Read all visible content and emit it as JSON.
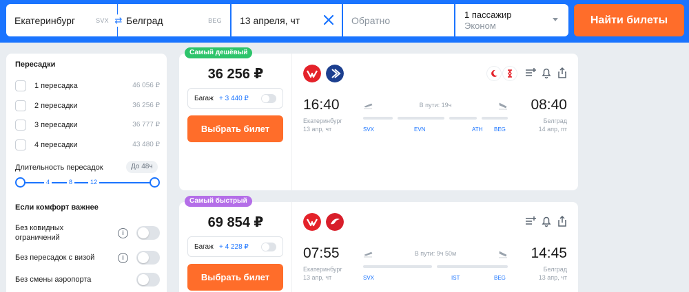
{
  "search": {
    "from_city": "Екатеринбург",
    "from_code": "SVX",
    "to_city": "Белград",
    "to_code": "BEG",
    "date": "13 апреля, чт",
    "return_placeholder": "Обратно",
    "passengers": "1 пассажир",
    "cabin": "Эконом",
    "find_button": "Найти билеты"
  },
  "filters": {
    "stops_title": "Пересадки",
    "stops": [
      {
        "label": "1 пересадка",
        "price": "46 056 ₽"
      },
      {
        "label": "2 пересадки",
        "price": "36 256 ₽"
      },
      {
        "label": "3 пересадки",
        "price": "36 777 ₽"
      },
      {
        "label": "4 пересадки",
        "price": "43 480 ₽"
      }
    ],
    "duration_label": "Длительность пересадок",
    "duration_badge": "До 48ч",
    "slider_ticks": [
      "4",
      "8",
      "12"
    ],
    "comfort_title": "Если комфорт важнее",
    "comfort": [
      {
        "label": "Без ковидных ограничений"
      },
      {
        "label": "Без пересадок с визой"
      },
      {
        "label": "Без смены аэропорта"
      }
    ]
  },
  "tickets": [
    {
      "tag": "Самый дешёвый",
      "price": "36 256 ₽",
      "baggage_label": "Багаж",
      "baggage_price": "+ 3 440 ₽",
      "select_button": "Выбрать билет",
      "dep_time": "16:40",
      "dep_city": "Екатеринбург",
      "dep_date": "13 апр, чт",
      "arr_time": "08:40",
      "arr_city": "Белград",
      "arr_date": "14 апр, пт",
      "duration": "В пути: 19ч",
      "airports": [
        "SVX",
        "EVN",
        "ATH",
        "BEG"
      ],
      "airlines": [
        "airline-logo-red",
        "airline-logo-blue"
      ]
    },
    {
      "tag": "Самый быстрый",
      "price": "69 854 ₽",
      "baggage_label": "Багаж",
      "baggage_price": "+ 4 228 ₽",
      "select_button": "Выбрать билет",
      "dep_time": "07:55",
      "dep_city": "Екатеринбург",
      "dep_date": "13 апр, чт",
      "arr_time": "14:45",
      "arr_city": "Белград",
      "arr_date": "13 апр, чт",
      "duration": "В пути: 9ч 50м",
      "airports": [
        "SVX",
        "IST",
        "BEG"
      ],
      "airlines": [
        "airline-logo-red",
        "turkish-airlines-logo"
      ]
    }
  ],
  "colors": {
    "accent": "#1a74ff",
    "cta": "#ff6d2a",
    "cheapest_tag": "#2dc46b",
    "fastest_tag": "#b46ee8"
  }
}
